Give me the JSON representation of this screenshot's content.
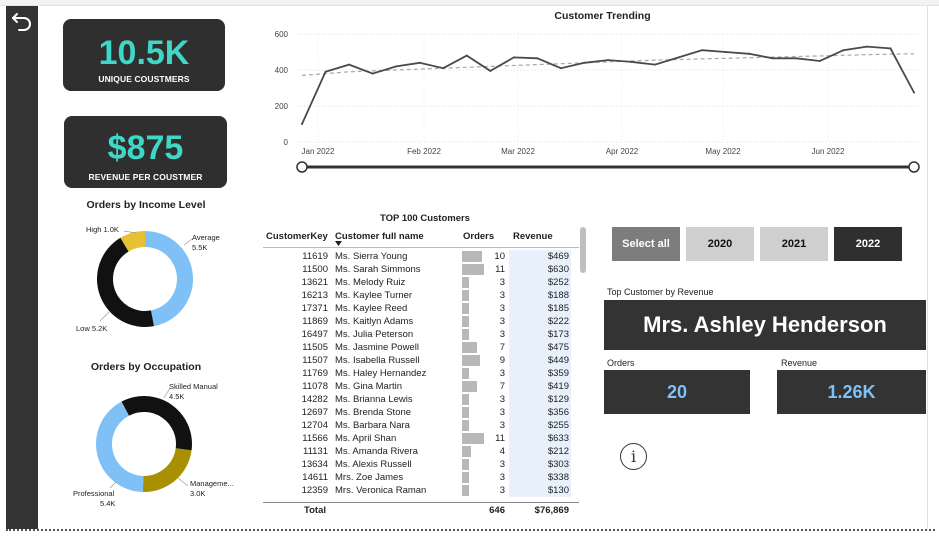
{
  "kpis": {
    "unique_customers_value": "10.5K",
    "unique_customers_label": "UNIQUE COUSTMERS",
    "revenue_per_customer_value": "$875",
    "revenue_per_customer_label": "REVENUE PER COUSTMER"
  },
  "trend_chart": {
    "title": "Customer Trending",
    "y_ticks": [
      "600",
      "400",
      "200",
      "0"
    ],
    "x_ticks": [
      "Jan 2022",
      "Feb 2022",
      "Mar 2022",
      "Apr 2022",
      "May 2022",
      "Jun 2022"
    ]
  },
  "income_chart": {
    "title": "Orders by Income Level",
    "labels": {
      "high": "High 1.0K",
      "average": "Average",
      "average_value": "5.5K",
      "low": "Low 5.2K"
    }
  },
  "occupation_chart": {
    "title": "Orders by Occupation",
    "labels": {
      "skilled": "Skilled Manual",
      "skilled_value": "4.5K",
      "management": "Manageme...",
      "management_value": "3.0K",
      "professional": "Professional",
      "professional_value": "5.4K"
    }
  },
  "table": {
    "title": "TOP 100 Customers",
    "headers": {
      "key": "CustomerKey",
      "name": "Customer full name",
      "orders": "Orders",
      "revenue": "Revenue"
    },
    "rows": [
      {
        "key": "11619",
        "name": "Ms. Sierra Young",
        "orders": "10",
        "revenue": "$469"
      },
      {
        "key": "11500",
        "name": "Ms. Sarah Simmons",
        "orders": "11",
        "revenue": "$630"
      },
      {
        "key": "13621",
        "name": "Ms. Melody Ruiz",
        "orders": "3",
        "revenue": "$252"
      },
      {
        "key": "16213",
        "name": "Ms. Kaylee Turner",
        "orders": "3",
        "revenue": "$188"
      },
      {
        "key": "17371",
        "name": "Ms. Kaylee Reed",
        "orders": "3",
        "revenue": "$185"
      },
      {
        "key": "11869",
        "name": "Ms. Kaitlyn Adams",
        "orders": "3",
        "revenue": "$222"
      },
      {
        "key": "16497",
        "name": "Ms. Julia Peterson",
        "orders": "3",
        "revenue": "$173"
      },
      {
        "key": "11505",
        "name": "Ms. Jasmine Powell",
        "orders": "7",
        "revenue": "$475"
      },
      {
        "key": "11507",
        "name": "Ms. Isabella Russell",
        "orders": "9",
        "revenue": "$449"
      },
      {
        "key": "11769",
        "name": "Ms. Haley Hernandez",
        "orders": "3",
        "revenue": "$359"
      },
      {
        "key": "11078",
        "name": "Ms. Gina Martin",
        "orders": "7",
        "revenue": "$419"
      },
      {
        "key": "14282",
        "name": "Ms. Brianna Lewis",
        "orders": "3",
        "revenue": "$129"
      },
      {
        "key": "12697",
        "name": "Ms. Brenda Stone",
        "orders": "3",
        "revenue": "$356"
      },
      {
        "key": "12704",
        "name": "Ms. Barbara Nara",
        "orders": "3",
        "revenue": "$255"
      },
      {
        "key": "11566",
        "name": "Ms. April Shan",
        "orders": "11",
        "revenue": "$633"
      },
      {
        "key": "11131",
        "name": "Ms. Amanda Rivera",
        "orders": "4",
        "revenue": "$212"
      },
      {
        "key": "13634",
        "name": "Ms. Alexis Russell",
        "orders": "3",
        "revenue": "$303"
      },
      {
        "key": "14611",
        "name": "Mrs. Zoe James",
        "orders": "3",
        "revenue": "$338"
      },
      {
        "key": "12359",
        "name": "Mrs. Veronica Raman",
        "orders": "3",
        "revenue": "$130"
      }
    ],
    "total_label": "Total",
    "total_orders": "646",
    "total_revenue": "$76,869"
  },
  "year_slicer": {
    "options": [
      "Select all",
      "2020",
      "2021",
      "2022"
    ],
    "selected": "2022"
  },
  "top_customer": {
    "label": "Top Customer by Revenue",
    "name": "Mrs. Ashley Henderson",
    "orders_label": "Orders",
    "orders_value": "20",
    "revenue_label": "Revenue",
    "revenue_value": "1.26K"
  },
  "info_icon_glyph": "i",
  "icons": [
    "back-arrow-icon",
    "info-icon",
    "sort-down-icon"
  ],
  "colors": {
    "card_bg": "#2f2f2f",
    "kpi_accent": "#3fd7c8",
    "blue_accent": "#5ab4f0",
    "light_blue": "#7fc1f7",
    "black": "#111111",
    "gold": "#e8c034",
    "olive_gold": "#a89000"
  },
  "chart_data": [
    {
      "type": "line",
      "title": "Customer Trending",
      "xlabel": "",
      "ylabel": "",
      "ylim": [
        0,
        600
      ],
      "x": [
        "Jan 2022",
        "Feb 2022",
        "Mar 2022",
        "Apr 2022",
        "May 2022",
        "Jun 2022"
      ],
      "series": [
        {
          "values": [
            100,
            390,
            430,
            380,
            420,
            440,
            410,
            480,
            395,
            470,
            465,
            410,
            440,
            455,
            445,
            430,
            470,
            510,
            500,
            490,
            465,
            465,
            450,
            510,
            530,
            520,
            275
          ]
        },
        {
          "values": [
            370,
            380,
            390,
            395,
            400,
            405,
            410,
            415,
            420,
            425,
            430,
            435,
            440,
            445,
            450,
            455,
            458,
            462,
            465,
            468,
            472,
            475,
            478,
            482,
            485,
            488,
            490
          ]
        }
      ]
    },
    {
      "type": "pie",
      "title": "Orders by Income Level",
      "categories": [
        "Average",
        "Low",
        "High"
      ],
      "values": [
        5.5,
        5.2,
        1.0
      ]
    },
    {
      "type": "pie",
      "title": "Orders by Occupation",
      "categories": [
        "Skilled Manual",
        "Manageme...",
        "Professional"
      ],
      "values": [
        4.5,
        3.0,
        5.4
      ]
    }
  ]
}
